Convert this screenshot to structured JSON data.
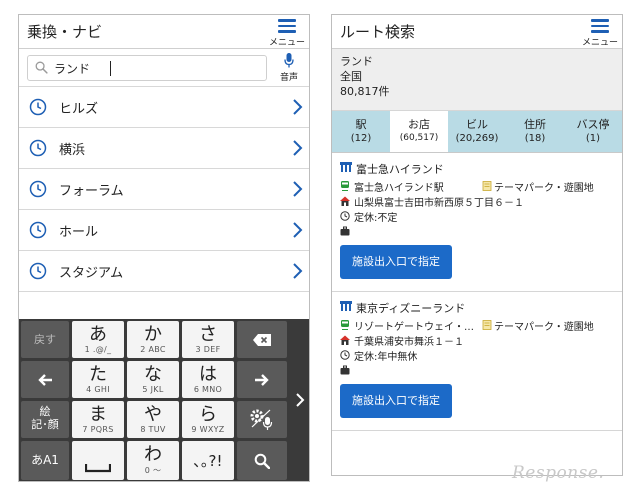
{
  "left": {
    "header": {
      "title": "乗換・ナビ",
      "menu_label": "メニュー"
    },
    "search": {
      "value": "ランド",
      "voice_label": "音声"
    },
    "history": [
      {
        "label": "ヒルズ"
      },
      {
        "label": "横浜"
      },
      {
        "label": "フォーラム"
      },
      {
        "label": "ホール"
      },
      {
        "label": "スタジアム"
      }
    ],
    "keyboard": {
      "back": "戻す",
      "keys": [
        {
          "main": "あ",
          "sub": "1 .@/_"
        },
        {
          "main": "か",
          "sub": "2 ABC"
        },
        {
          "main": "さ",
          "sub": "3 DEF"
        },
        {
          "main": "た",
          "sub": "4 GHI"
        },
        {
          "main": "な",
          "sub": "5 JKL"
        },
        {
          "main": "は",
          "sub": "6 MNO"
        },
        {
          "main": "ま",
          "sub": "7 PQRS"
        },
        {
          "main": "や",
          "sub": "8 TUV"
        },
        {
          "main": "ら",
          "sub": "9 WXYZ"
        },
        {
          "main": "わ",
          "sub": "0 ～"
        }
      ],
      "emoji_line1": "絵",
      "emoji_line2": "記･顔",
      "mode": "あA1",
      "punct": "､｡?!"
    }
  },
  "right": {
    "header": {
      "title": "ルート検索",
      "menu_label": "メニュー"
    },
    "query": {
      "keyword": "ランド",
      "area": "全国",
      "count": "80,817件"
    },
    "tabs": [
      {
        "label": "駅",
        "count": "(12)",
        "active": false
      },
      {
        "label": "お店",
        "count": "(60,517)",
        "active": true
      },
      {
        "label": "ビル",
        "count": "(20,269)",
        "active": false
      },
      {
        "label": "住所",
        "count": "(18)",
        "active": false
      },
      {
        "label": "バス停",
        "count": "(1)",
        "active": false
      }
    ],
    "results": [
      {
        "name": "富士急ハイランド",
        "station": "富士急ハイランド駅",
        "category": "テーマパーク・遊園地",
        "address": "山梨県富士吉田市新西原５丁目６－１",
        "holiday": "定休:不定",
        "button": "施設出入口で指定"
      },
      {
        "name": "東京ディズニーランド",
        "station": "リゾートゲートウェイ・…",
        "category": "テーマパーク・遊園地",
        "address": "千葉県浦安市舞浜１－１",
        "holiday": "定休:年中無休",
        "button": "施設出入口で指定"
      }
    ]
  },
  "watermark": "Response."
}
